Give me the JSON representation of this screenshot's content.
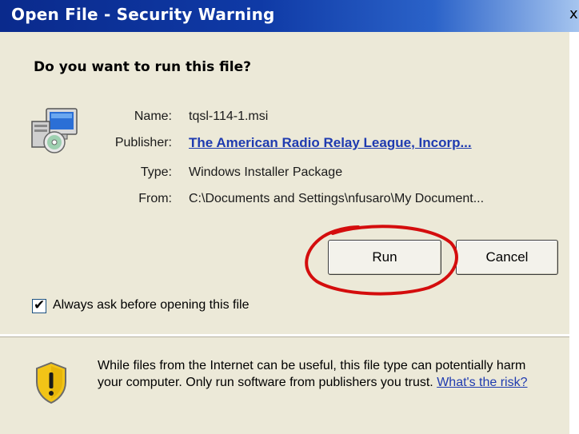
{
  "window": {
    "title": "Open File - Security Warning",
    "close_glyph": "x"
  },
  "prompt": {
    "question": "Do you want to run this file?"
  },
  "details": {
    "name_label": "Name:",
    "name_value": "tqsl-114-1.msi",
    "publisher_label": "Publisher:",
    "publisher_value": "The American Radio Relay League, Incorp...",
    "type_label": "Type:",
    "type_value": "Windows Installer Package",
    "from_label": "From:",
    "from_value": "C:\\Documents and Settings\\nfusaro\\My Document..."
  },
  "buttons": {
    "run_label": "Run",
    "cancel_label": "Cancel"
  },
  "checkbox": {
    "label": "Always ask before opening this file",
    "checked": true
  },
  "warning": {
    "text": "While files from the Internet can be useful, this file type can potentially harm your computer. Only run software from publishers you trust.",
    "link_text": "What's the risk?"
  },
  "icons": {
    "file_icon": "installer-package-icon",
    "warning_icon": "shield-warning-icon"
  },
  "colors": {
    "titlebar": "#0f3aa6",
    "panel": "#ece9d8",
    "link": "#1f3bb0",
    "annotation": "#d40d0d"
  }
}
